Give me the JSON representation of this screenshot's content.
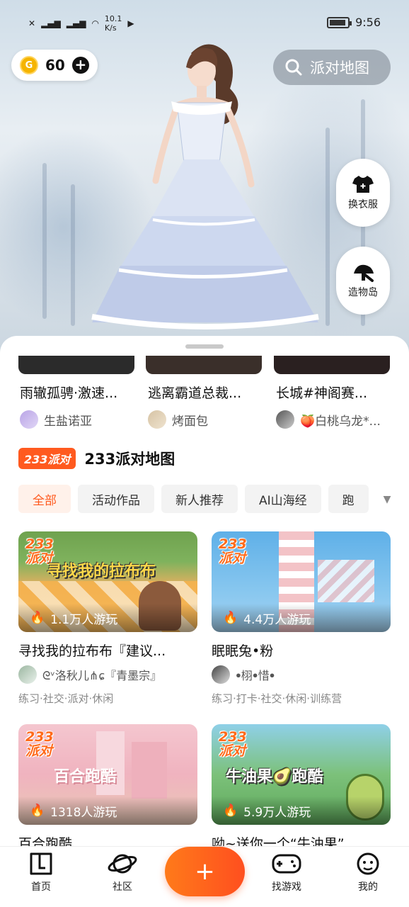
{
  "status_bar": {
    "speed": "10.1",
    "speed_unit": "K/s",
    "time": "9:56"
  },
  "coins": {
    "count": "60"
  },
  "search": {
    "label": "派对地图"
  },
  "side_buttons": [
    {
      "label": "换衣服",
      "icon": "tshirt-icon"
    },
    {
      "label": "造物岛",
      "icon": "island-icon"
    }
  ],
  "recent": [
    {
      "title": "雨辙孤骋·激速...",
      "author": "生盐诺亚"
    },
    {
      "title": "逃离霸道总裁...",
      "author": "烤面包"
    },
    {
      "title": "长城#神阁赛...",
      "author": "🍑白桃乌龙*..."
    }
  ],
  "section": {
    "badge": "233派对",
    "title": "233派对地图"
  },
  "tabs": [
    "全部",
    "活动作品",
    "新人推荐",
    "AI山海经",
    "跑"
  ],
  "cards": [
    {
      "badge": "233派对",
      "overlay": "寻找我的拉布布",
      "plays": "1.1万人游玩",
      "title": "寻找我的拉布布『建议...",
      "author": "ᘓᵛ洛秋儿⋔ɕ『青墨宗』",
      "tags": "练习·社交·派对·休闲"
    },
    {
      "badge": "233派对",
      "overlay": "",
      "plays": "4.4万人游玩",
      "title": "眠眠兔•粉",
      "author": "ꔷ栩ꔷ惜ꔷ",
      "tags": "练习·打卡·社交·休闲·训练营"
    },
    {
      "badge": "233派对",
      "overlay": "百合跑酷",
      "plays": "1318人游玩",
      "title": "百合跑酷",
      "author": "",
      "tags": ""
    },
    {
      "badge": "233派对",
      "overlay": "牛油果🥑跑酷",
      "plays": "5.9万人游玩",
      "title": "呦~送你一个“牛油果”",
      "author": "",
      "tags": ""
    }
  ],
  "bottom_nav": [
    {
      "label": "首页",
      "icon": "home-icon"
    },
    {
      "label": "社区",
      "icon": "planet-icon"
    },
    {
      "label": "+",
      "icon": "plus-icon"
    },
    {
      "label": "找游戏",
      "icon": "gamepad-icon"
    },
    {
      "label": "我的",
      "icon": "profile-icon"
    }
  ],
  "colors": {
    "accent": "#ff5a1f",
    "coin": "#f5b400"
  }
}
